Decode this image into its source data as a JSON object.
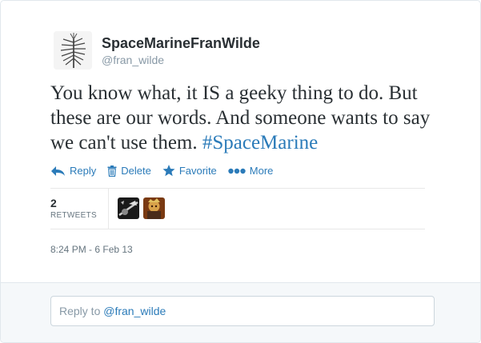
{
  "tweet": {
    "author": {
      "fullname": "SpaceMarineFranWilde",
      "username": "@fran_wilde",
      "avatar": "leafy-stalk-photo"
    },
    "text": "You know what, it IS a geeky thing to do. But these are our words. And someone wants to say we can't use them. ",
    "hashtag": "#SpaceMarine",
    "timestamp": "8:24 PM - 6 Feb 13"
  },
  "actions": {
    "reply": {
      "label": "Reply",
      "icon": "reply-arrow-icon"
    },
    "delete": {
      "label": "Delete",
      "icon": "trash-icon"
    },
    "favorite": {
      "label": "Favorite",
      "icon": "star-icon"
    },
    "more": {
      "label": "More",
      "icon": "dots-icon"
    }
  },
  "stats": {
    "retweet_count": "2",
    "retweet_label": "RETWEETS",
    "retweeters": [
      "retweeter-avatar-1",
      "retweeter-avatar-2"
    ]
  },
  "reply_box": {
    "prefix": "Reply to ",
    "handle": "@fran_wilde"
  },
  "colors": {
    "link": "#2b7bb9",
    "text": "#292f33",
    "muted": "#8899a6",
    "border": "#e1e8ed"
  }
}
